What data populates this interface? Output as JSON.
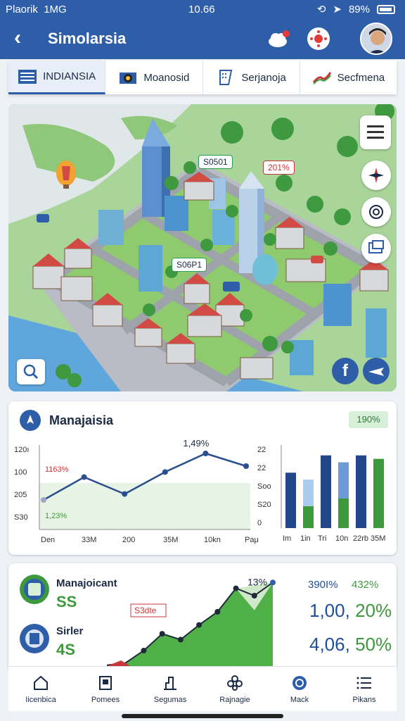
{
  "status": {
    "carrier": "Plaorik",
    "network": "1MG",
    "time": "10.66",
    "battery": "89%"
  },
  "appbar": {
    "title": "Simolarsia"
  },
  "tabs": [
    {
      "label": "INDIANSIA",
      "icon": "list-icon"
    },
    {
      "label": "Moanosid",
      "icon": "camera-icon"
    },
    {
      "label": "Serjanoja",
      "icon": "grid-doc-icon"
    },
    {
      "label": "Secfmena",
      "icon": "trend-icon"
    }
  ],
  "map": {
    "label1": "S0501",
    "label2": "201%",
    "label3": "S06P1"
  },
  "chart_card": {
    "title": "Manajaisia",
    "badge": "190%"
  },
  "chart_data": [
    {
      "type": "line",
      "y_ticks": [
        "120ı",
        "100",
        "205",
        "S30"
      ],
      "x_ticks": [
        "Den",
        "33M",
        "200",
        "35M",
        "10kn",
        "Paμ"
      ],
      "annotations": [
        "1,49%",
        "1163%",
        "1,23%"
      ],
      "series": [
        {
          "values": [
            35,
            62,
            42,
            68,
            90,
            75
          ]
        }
      ],
      "ylim": [
        0,
        100
      ]
    },
    {
      "type": "bar",
      "y_ticks": [
        "22",
        "22",
        "Soo",
        "S20",
        "0"
      ],
      "x_ticks": [
        "Im",
        "1in",
        "Tri",
        "10n",
        "22rb",
        "35M"
      ],
      "series": [
        {
          "values": [
            80,
            70,
            105,
            95,
            105,
            100
          ]
        },
        {
          "values": [
            0,
            0,
            0,
            0,
            0,
            0
          ]
        }
      ],
      "ylim": [
        0,
        120
      ]
    },
    {
      "type": "area",
      "annotations": [
        "13%",
        "S3dte"
      ],
      "series": [
        {
          "values": [
            5,
            8,
            25,
            48,
            40,
            60,
            78,
            110,
            100,
            118
          ]
        }
      ],
      "ylim": [
        0,
        125
      ]
    }
  ],
  "stats": {
    "item1_label": "Manajoicant",
    "item1_value": "SS",
    "item2_label": "Sirler",
    "item2_value": "4S",
    "pct1": "390I%",
    "pct2": "432%",
    "big1_a": "1,00,",
    "big1_b": "20%",
    "big2_a": "4,06,",
    "big2_b": "50%"
  },
  "bottom_nav": [
    {
      "label": "Iicenbica",
      "icon": "home-icon"
    },
    {
      "label": "Pomees",
      "icon": "document-icon"
    },
    {
      "label": "Segumas",
      "icon": "building-icon"
    },
    {
      "label": "Rajnagie",
      "icon": "flower-icon"
    },
    {
      "label": "Mack",
      "icon": "target-icon"
    },
    {
      "label": "Pikans",
      "icon": "menu-icon"
    }
  ],
  "colors": {
    "primary": "#2f5ea8",
    "green": "#3c9a3c",
    "red": "#c8373a"
  }
}
